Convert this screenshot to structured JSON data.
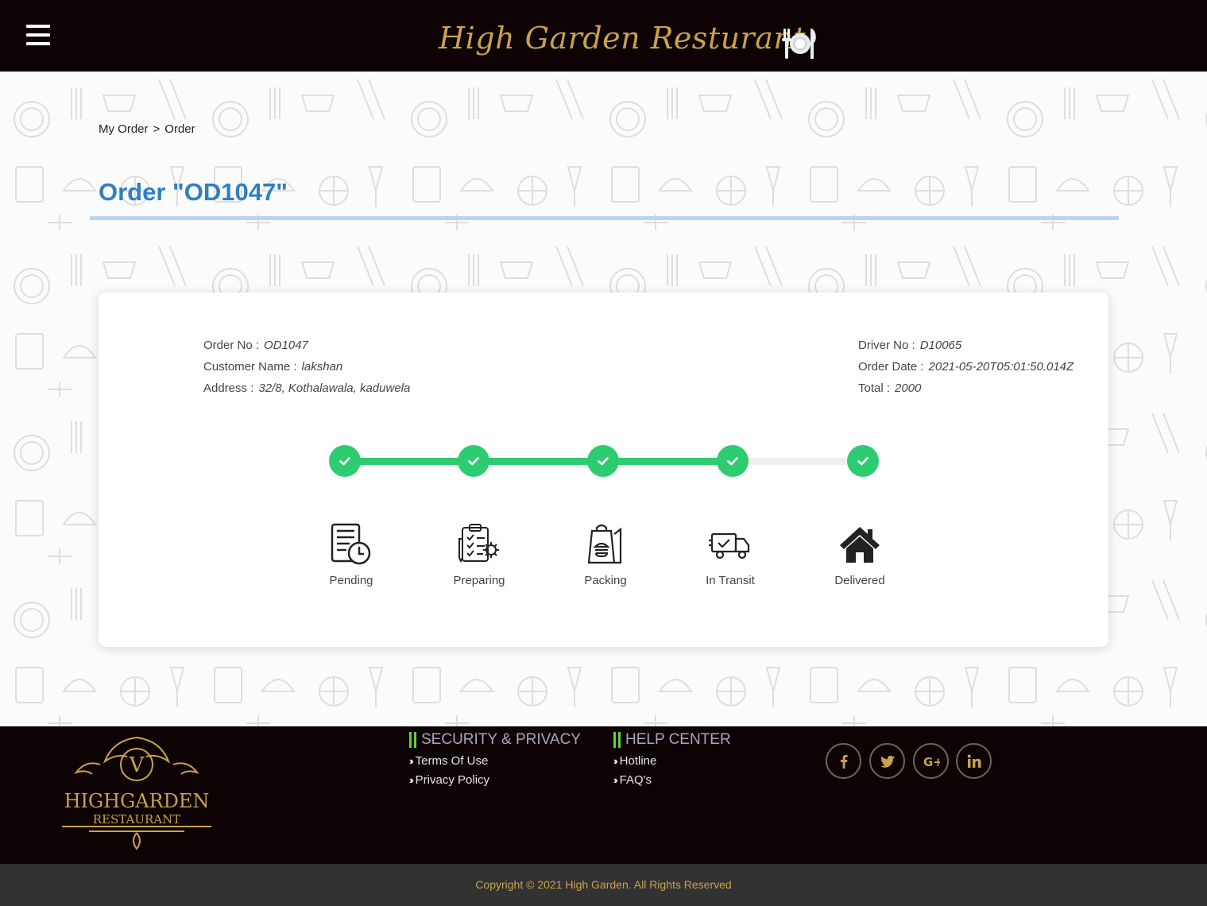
{
  "header": {
    "brand": "High Garden Resturant",
    "brand_icon": "plate-cutlery-icon",
    "menu_icon": "hamburger-menu-icon"
  },
  "breadcrumb": {
    "items": [
      "My Order",
      "Order"
    ],
    "separator": ">"
  },
  "page": {
    "title": "Order \"OD1047\""
  },
  "order": {
    "left": [
      {
        "label": "Order No :",
        "value": "OD1047"
      },
      {
        "label": "Customer Name :",
        "value": "lakshan"
      },
      {
        "label": "Address :",
        "value": "32/8, Kothalawala, kaduwela"
      }
    ],
    "right": [
      {
        "label": "Driver No :",
        "value": "D10065"
      },
      {
        "label": "Order Date :",
        "value": "2021-05-20T05:01:50.014Z"
      },
      {
        "label": "Total :",
        "value": "2000"
      }
    ]
  },
  "progress": {
    "steps": [
      {
        "label": "Pending",
        "icon": "order-pending-clock-icon",
        "done": true
      },
      {
        "label": "Preparing",
        "icon": "clipboard-gear-icon",
        "done": true
      },
      {
        "label": "Packing",
        "icon": "food-bag-icon",
        "done": true
      },
      {
        "label": "In Transit",
        "icon": "delivery-truck-icon",
        "done": true
      },
      {
        "label": "Delivered",
        "icon": "house-icon",
        "done": true
      }
    ],
    "completed_segments": 3,
    "total_segments": 4,
    "color_done": "#2ecc71",
    "color_todo": "#efefef"
  },
  "footer": {
    "logo_text": [
      "V",
      "HIGHGARDEN",
      "RESTAURANT"
    ],
    "security": {
      "heading": "SECURITY & PRIVACY",
      "links": [
        "Terms Of Use",
        "Privacy Policy"
      ]
    },
    "help": {
      "heading": "HELP CENTER",
      "links": [
        "Hotline",
        "FAQ's"
      ]
    },
    "social": [
      "facebook-icon",
      "twitter-icon",
      "google-plus-icon",
      "linkedin-icon"
    ],
    "copyright": "Copyright © 2021 High Garden. All Rights Reserved"
  },
  "colors": {
    "header_bg": "#0d0304",
    "brand_gold": "#c9a24e",
    "title_blue": "#2f7fc1",
    "footer_accent": "#63d13a"
  }
}
